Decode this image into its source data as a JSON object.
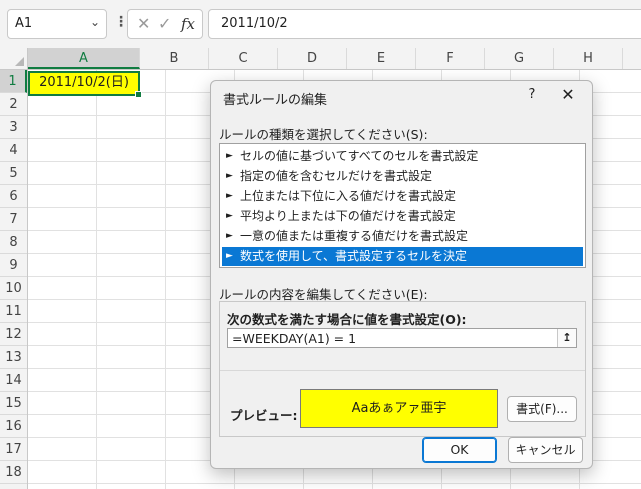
{
  "formula_bar": {
    "name_box": "A1",
    "name_box_icon": "chevron-down-icon",
    "separator": "⋮",
    "cancel_icon": "✕",
    "enter_icon": "✓",
    "fx_label": "fx",
    "formula": "2011/10/2"
  },
  "grid": {
    "columns": [
      "A",
      "B",
      "C",
      "D",
      "E",
      "F",
      "G",
      "H"
    ],
    "selected_column": "A",
    "rows": [
      "1",
      "2",
      "3",
      "4",
      "5",
      "6",
      "7",
      "8",
      "9",
      "10",
      "11",
      "12",
      "13",
      "14",
      "15",
      "16",
      "17",
      "18"
    ],
    "selected_row": "1",
    "cell_a1": {
      "value": "2011/10/2(日)",
      "fill_color": "#ffff00"
    }
  },
  "dialog": {
    "title": "書式ルールの編集",
    "help_label": "?",
    "close_label": "✕",
    "rule_type_label": "ルールの種類を選択してください(S):",
    "rule_types": [
      {
        "arrow": "►",
        "label": "セルの値に基づいてすべてのセルを書式設定"
      },
      {
        "arrow": "►",
        "label": "指定の値を含むセルだけを書式設定"
      },
      {
        "arrow": "►",
        "label": "上位または下位に入る値だけを書式設定"
      },
      {
        "arrow": "►",
        "label": "平均より上または下の値だけを書式設定"
      },
      {
        "arrow": "►",
        "label": "一意の値または重複する値だけを書式設定"
      },
      {
        "arrow": "►",
        "label": "数式を使用して、書式設定するセルを決定"
      }
    ],
    "selected_rule_index": 5,
    "edit_label": "ルールの内容を編集してください(E):",
    "formula_label": "次の数式を満たす場合に値を書式設定(O):",
    "formula_value": "=WEEKDAY(A1) = 1",
    "collapse_icon": "↥",
    "preview_label": "プレビュー:",
    "preview_text": "Aaあぁアァ亜宇",
    "preview_color": "#ffff00",
    "format_button": "書式(F)...",
    "ok_button": "OK",
    "cancel_button": "キャンセル",
    "accent_color": "#0a78d4"
  }
}
